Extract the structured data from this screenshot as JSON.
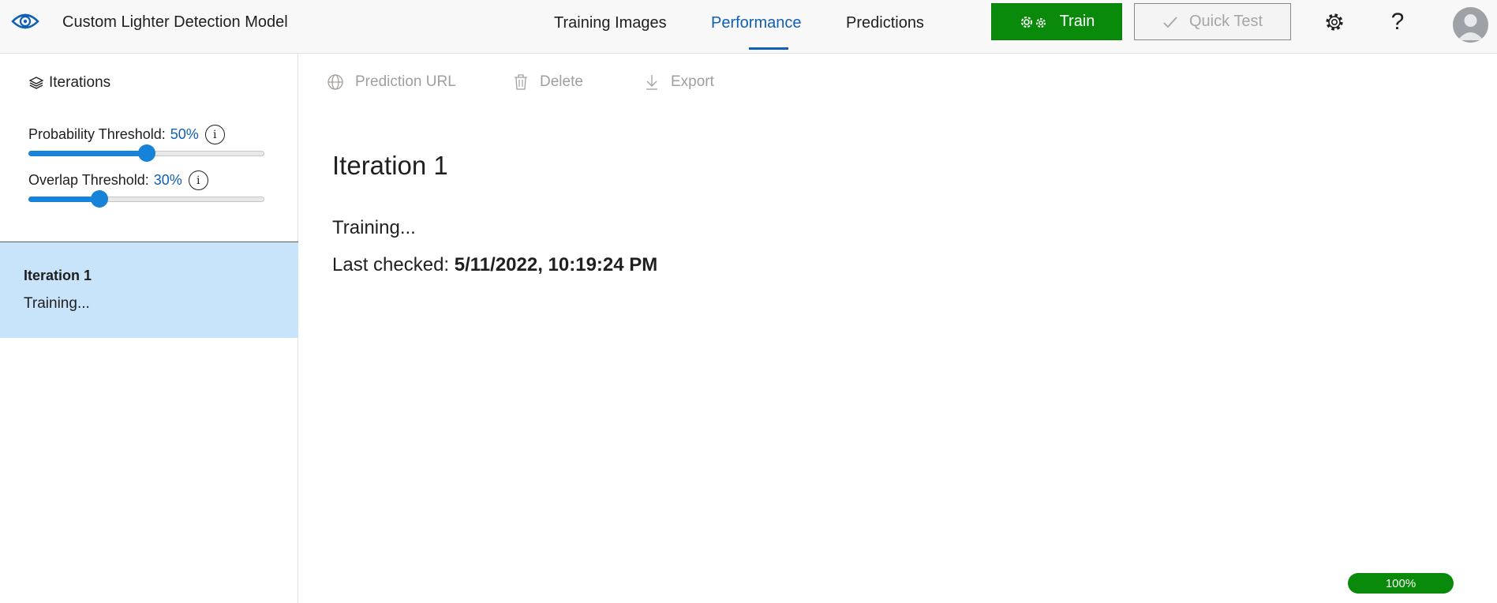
{
  "header": {
    "app_title": "Custom Lighter Detection Model",
    "tabs": [
      {
        "label": "Training Images",
        "active": false
      },
      {
        "label": "Performance",
        "active": true
      },
      {
        "label": "Predictions",
        "active": false
      }
    ],
    "train_label": "Train",
    "quick_test_label": "Quick Test",
    "help_label": "?",
    "icons": [
      "eye-logo-icon",
      "gears-icon",
      "checkmark-icon",
      "settings-gear-icon",
      "help-icon",
      "user-avatar-icon"
    ]
  },
  "sidebar": {
    "heading": "Iterations",
    "probability": {
      "label": "Probability Threshold:",
      "value": "50%",
      "fraction": 0.5
    },
    "overlap": {
      "label": "Overlap Threshold:",
      "value": "30%",
      "fraction": 0.3
    },
    "info_glyph": "i",
    "iterations": [
      {
        "name": "Iteration 1",
        "status": "Training...",
        "selected": true
      }
    ]
  },
  "toolbar": {
    "prediction_url": "Prediction URL",
    "delete": "Delete",
    "export": "Export"
  },
  "main": {
    "title": "Iteration 1",
    "status": "Training...",
    "last_checked_label": "Last checked:",
    "last_checked_value": "5/11/2022, 10:19:24 PM"
  },
  "zoom": "100%",
  "colors": {
    "accent": "#0f5fb4",
    "train_green": "#0a8a0a",
    "selected_bg": "#c7e4fb",
    "slider": "#1683d8"
  }
}
